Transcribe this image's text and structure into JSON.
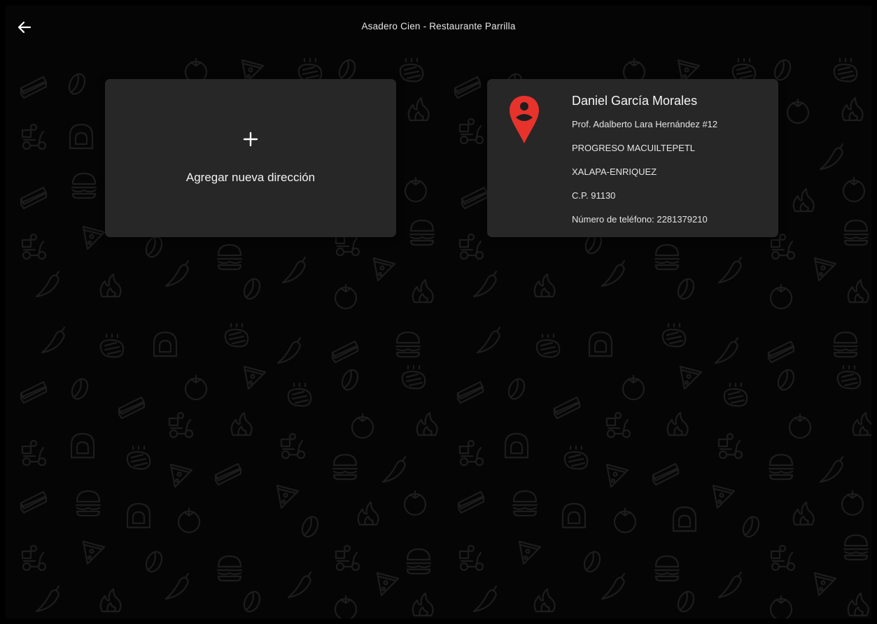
{
  "header": {
    "title": "Asadero Cien - Restaurante Parrilla",
    "back_icon": "arrow-left-icon"
  },
  "add_card": {
    "icon": "plus-icon",
    "label": "Agregar nueva dirección"
  },
  "address_card": {
    "icon": "location-pin-person-icon",
    "name": "Daniel García Morales",
    "street": "Prof. Adalberto Lara Hernández #12",
    "neighborhood": "PROGRESO MACUILTEPETL",
    "city": "XALAPA-ENRIQUEZ",
    "postal_code": "C.P. 91130",
    "phone": "Número de teléfono: 2281379210"
  },
  "theme": {
    "background": "#050505",
    "card": "#272727",
    "accent": "#e8322c",
    "pattern_stroke": "#1f1f1f"
  },
  "background_pattern": {
    "icons": [
      "cake-icon",
      "coffee-bean-icon",
      "tomato-icon",
      "pizza-slice-icon",
      "steak-icon",
      "fire-icon",
      "burger-icon",
      "chili-pepper-icon",
      "oven-icon",
      "scooter-icon"
    ]
  }
}
